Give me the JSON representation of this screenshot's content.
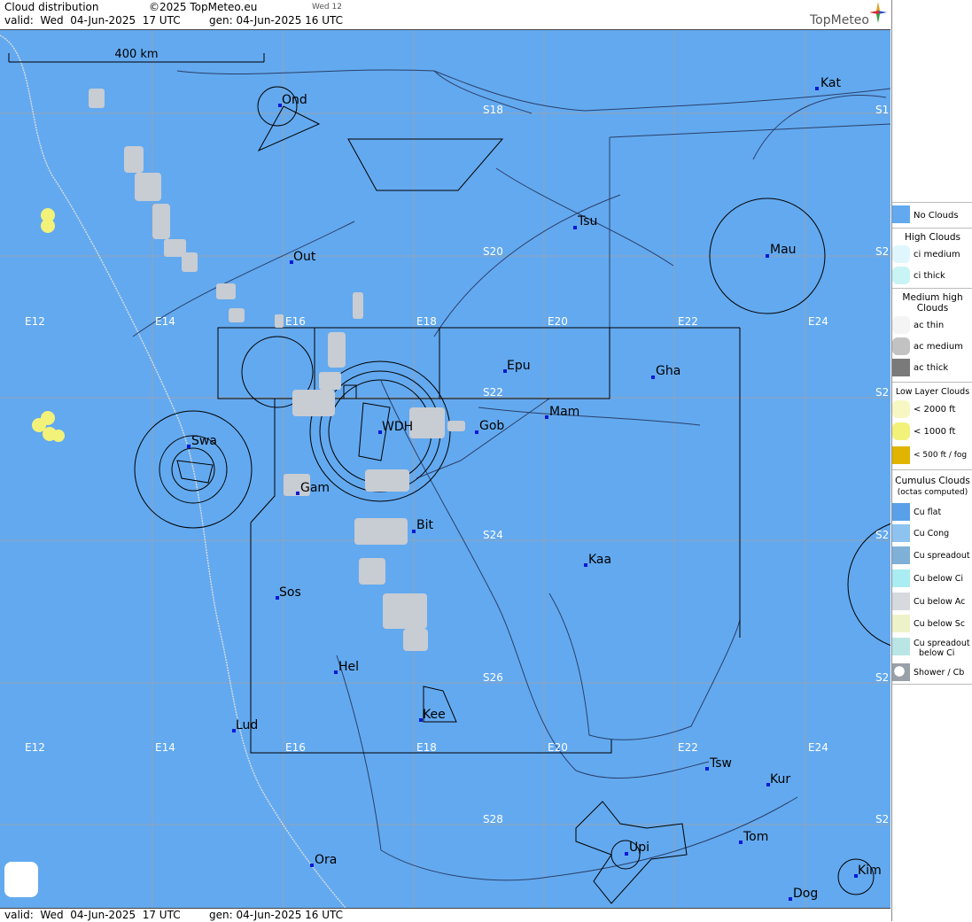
{
  "header": {
    "title": "Cloud distribution",
    "copyright": "©2025 TopMeteo.eu",
    "day_tag": "Wed 12",
    "valid_line": "valid:  Wed  04-Jun-2025  17 UTC",
    "gen_line": "gen: 04-Jun-2025 16 UTC",
    "brand": "TopMeteo"
  },
  "footer": {
    "valid_line": "valid:  Wed  04-Jun-2025  17 UTC",
    "gen_line": "gen: 04-Jun-2025 16 UTC"
  },
  "map": {
    "scale_label": "400 km",
    "grid_lon_labels_top": [
      "E12",
      "E14",
      "E16",
      "E18",
      "E20",
      "E22",
      "E24"
    ],
    "grid_lon_labels_bottom": [
      "E12",
      "E14",
      "E16",
      "E18",
      "E20",
      "E22",
      "E24"
    ],
    "grid_lat_labels": [
      "S18",
      "S20",
      "S22",
      "S24",
      "S26",
      "S28"
    ],
    "grid_lat_labels_right": [
      "S1",
      "S2",
      "S2",
      "S2",
      "S2",
      "S2",
      "S2"
    ],
    "places": [
      {
        "name": "Ond"
      },
      {
        "name": "Kat"
      },
      {
        "name": "Tsu"
      },
      {
        "name": "Mau"
      },
      {
        "name": "Out"
      },
      {
        "name": "Epu"
      },
      {
        "name": "Gha"
      },
      {
        "name": "Mam"
      },
      {
        "name": "Swa"
      },
      {
        "name": "WDH"
      },
      {
        "name": "Gob"
      },
      {
        "name": "Gam"
      },
      {
        "name": "Bit"
      },
      {
        "name": "Kaa"
      },
      {
        "name": "Sos"
      },
      {
        "name": "Hel"
      },
      {
        "name": "Lud"
      },
      {
        "name": "Kee"
      },
      {
        "name": "Tsw"
      },
      {
        "name": "Kur"
      },
      {
        "name": "Tom"
      },
      {
        "name": "Ora"
      },
      {
        "name": "Upi"
      },
      {
        "name": "Kim"
      },
      {
        "name": "Dog"
      }
    ]
  },
  "legend": {
    "no_clouds": "No Clouds",
    "high_head": "High Clouds",
    "ci_medium": "ci medium",
    "ci_thick": "ci thick",
    "medium_head_1": "Medium high",
    "medium_head_2": "Clouds",
    "ac_thin": "ac thin",
    "ac_medium": "ac medium",
    "ac_thick": "ac thick",
    "low_head": "Low Layer Clouds",
    "low_2000": "< 2000 ft",
    "low_1000": "< 1000 ft",
    "low_500": "< 500 ft / fog",
    "cu_head_1": "Cumulus Clouds",
    "cu_head_2": "(octas computed)",
    "cu_flat": "Cu flat",
    "cu_cong": "Cu Cong",
    "cu_spread": "Cu spreadout",
    "cu_below_ci": "Cu below Ci",
    "cu_below_ac": "Cu below Ac",
    "cu_below_sc": "Cu below Sc",
    "cu_spread_ci_1": "Cu spreadout",
    "cu_spread_ci_2": "below Ci",
    "shower": "Shower / Cb"
  },
  "colors": {
    "sea_land": "#63a9ef",
    "low_cloud": "#f2f27a",
    "cu_below_ac": "#c8ccd3",
    "grid": "#b0b4bc"
  }
}
